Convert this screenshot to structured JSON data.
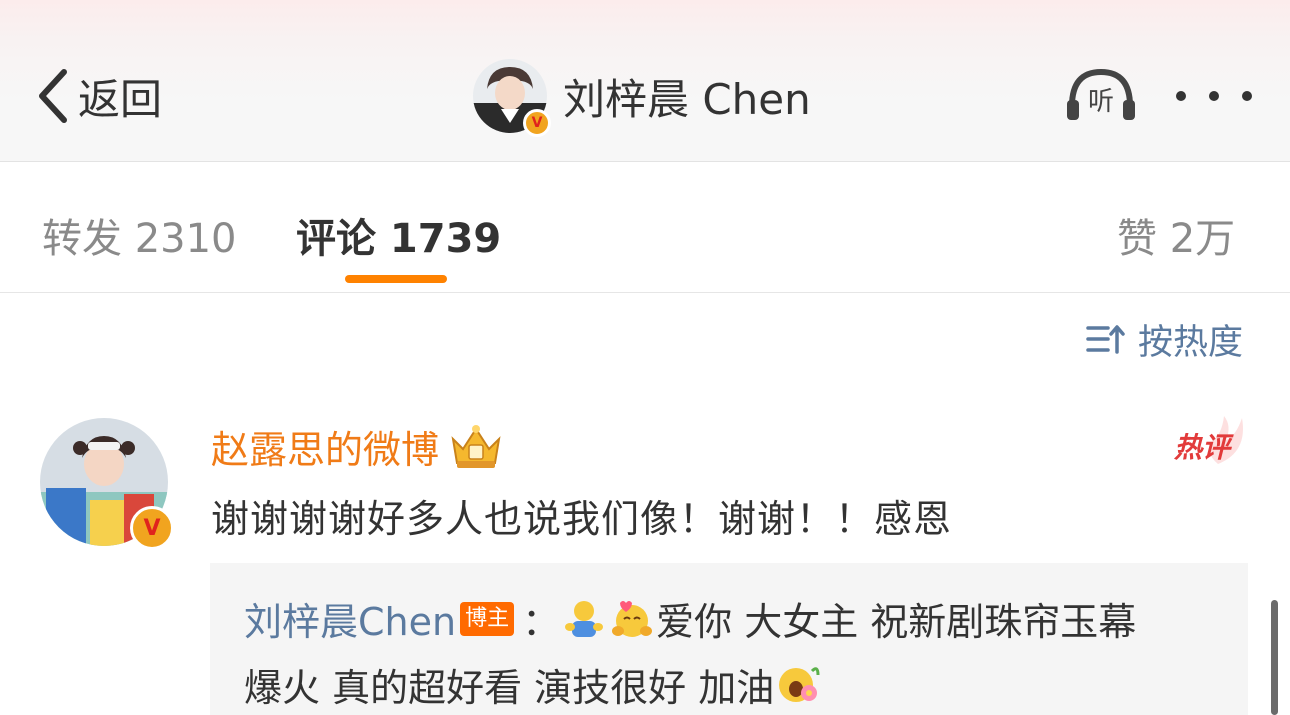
{
  "header": {
    "back_label": "返回",
    "title": "刘梓晨 Chen",
    "listen_label": "听"
  },
  "tabs": [
    {
      "label": "转发 2310",
      "active": false
    },
    {
      "label": "评论 1739",
      "active": true
    },
    {
      "label": "赞 2万",
      "active": false
    }
  ],
  "sort": {
    "label": "按热度"
  },
  "comment": {
    "user": "赵露思的微博",
    "hot_label": "热评",
    "text": "谢谢谢谢好多人也说我们像！谢谢！！感恩",
    "reply": {
      "user": "刘梓晨Chen",
      "badge": "博主",
      "separator": "：",
      "line1": "爱你 大女主 祝新剧珠帘玉幕",
      "line2": "爆火 真的超好看 演技很好 加油"
    }
  },
  "colors": {
    "accent": "#ff8200",
    "username": "#f07b17",
    "link_blue": "#5b7a9f",
    "verified": "#f1a41f"
  }
}
